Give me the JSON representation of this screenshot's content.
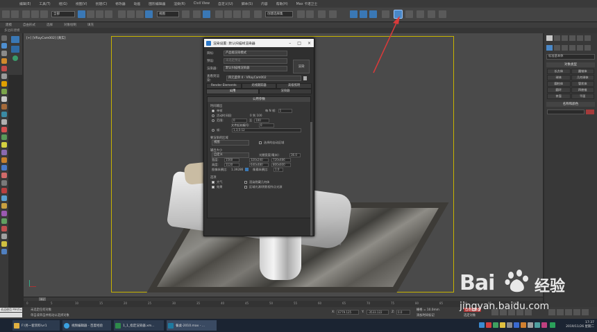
{
  "menu": {
    "items": [
      "编辑(E)",
      "工具(T)",
      "组(G)",
      "视图(V)",
      "创建(C)",
      "修改器",
      "动画",
      "图形编辑器",
      "渲染(R)",
      "Civil View",
      "自定义(U)",
      "脚本(S)",
      "内容",
      "帮助(H)",
      "Max 卡诺卫士"
    ]
  },
  "toolbar": {
    "selection_filter": "全部",
    "view_select": "视图",
    "named_selection": "创建选择集"
  },
  "ribbon": {
    "tabs": [
      "建模",
      "自由形式",
      "选择",
      "对象绘制",
      "填充"
    ],
    "sub_label": "多边形建模"
  },
  "viewport": {
    "label": "[+] [VRayCam002] [真实]"
  },
  "dialog": {
    "title": "渲染设置: 默认扫描线渲染器",
    "target_label": "目标:",
    "target_value": "产品级渲染模式",
    "preset_label": "预设:",
    "preset_value": "未选定预设",
    "renderer_label": "渲染器:",
    "renderer_value": "默认扫描线渲染器",
    "view_label": "查看到渲染:",
    "view_value": "四元菜单 4 - VRayCam002",
    "render_button": "渲染",
    "tabs_row1": [
      "Render Elements",
      "光线跟踪器",
      "高级照明"
    ],
    "tabs_row2": [
      "公用",
      "渲染器"
    ],
    "panel_title": "公用参数",
    "time_output": "时间输出",
    "opt_single": "单帧",
    "every_n": "每 N 帧:",
    "every_n_value": "1",
    "opt_active": "活动时间段:",
    "active_range": "0 到 100",
    "opt_range": "范围:",
    "range_from": "0",
    "range_to_label": "至",
    "range_to": "100",
    "file_numbering": "文件起始编号:",
    "file_num_value": "0",
    "opt_frames": "帧:",
    "frames_value": "1,3,5-12",
    "area_section": "要渲染的区域",
    "area_value": "视图",
    "auto_region": "选择的自动区域",
    "output_section": "输出大小",
    "output_value": "自定义",
    "aperture_label": "光圈宽度(毫米):",
    "aperture_value": "36.0",
    "width_label": "宽度:",
    "width_value": "1560",
    "height_label": "高度:",
    "height_value": "1120",
    "preset_sizes": [
      "320x240",
      "720x486",
      "640x480",
      "800x600"
    ],
    "image_aspect_label": "图像纵横比:",
    "image_aspect_value": "1.39286",
    "pixel_aspect_label": "像素纵横比:",
    "pixel_aspect_value": "1.0",
    "options_section": "选项",
    "opt_atmos": "大气",
    "opt_hidden": "渲染隐藏几何体",
    "opt_effects": "效果",
    "opt_area_lights": "区域光源/阴影视作点光源"
  },
  "rightpanel": {
    "dropdown": "标准基本体",
    "object_type": "对象类型",
    "buttons": [
      "长方体",
      "圆锥体",
      "球体",
      "几何球体",
      "圆柱体",
      "管状体",
      "圆环",
      "四棱锥",
      "茶壶",
      "平面"
    ],
    "name_color": "名称和颜色"
  },
  "timeline": {
    "frame": "0 / 100",
    "ticks": [
      "0",
      "5",
      "10",
      "15",
      "20",
      "25",
      "30",
      "35",
      "40",
      "45",
      "50",
      "55",
      "60",
      "65",
      "70",
      "75",
      "80",
      "85",
      "90",
      "95",
      "100"
    ]
  },
  "status": {
    "welcome": "欢迎使用 MAXSc",
    "line1": "未选定任何对象",
    "line2": "单击或单击并拖动以选择对象",
    "x_label": "X:",
    "x_value": "6779.125",
    "y_label": "Y:",
    "y_value": "-3533.122",
    "z_label": "Z:",
    "z_value": "0.0",
    "grid": "栅格 = 10.0mm",
    "autokey": "自动关键点",
    "selected": "选定对象",
    "add_tag": "添加时间标记"
  },
  "taskbar": {
    "items": [
      "F:\\另一套资料\\vr1",
      "视频编辑器 - 百度经验",
      "1_1_指定渲染器.xm...",
      "餐桌-2010.max - ..."
    ],
    "clock_time": "17:37",
    "clock_date": "2019/11/26 星期二"
  },
  "watermark": {
    "brand_a": "Bai",
    "brand_b": "经验",
    "url": "jingyan.baidu.com"
  },
  "colors": {
    "accent": "#3a78b5",
    "safe_frame": "#c8b400",
    "arrow": "#d93a3a"
  }
}
